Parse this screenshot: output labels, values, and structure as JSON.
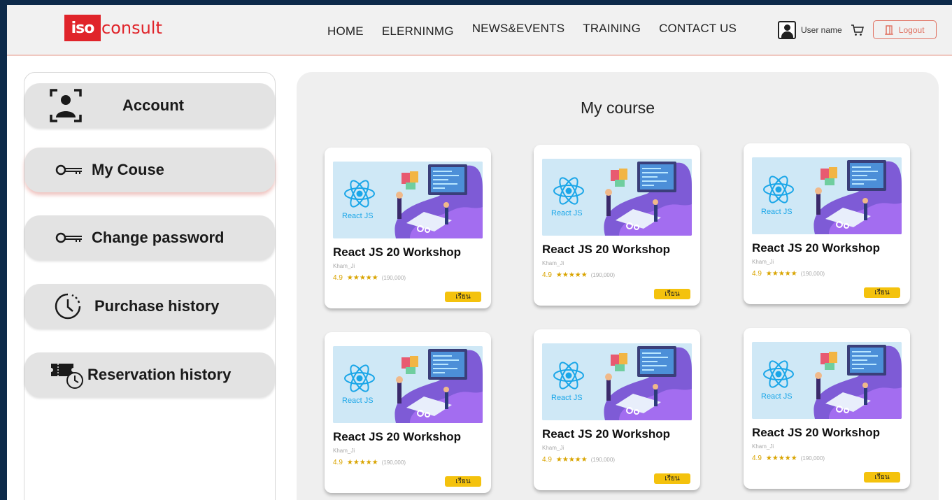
{
  "brand": {
    "logo_mark": "iso",
    "logo_text": "consult"
  },
  "nav": [
    "HOME",
    "ELERNINMG",
    "NEWS&EVENTS",
    "TRAINING",
    "CONTACT US"
  ],
  "user": {
    "name": "User name",
    "logout": "Logout"
  },
  "sidebar": {
    "items": [
      {
        "label": "Account",
        "icon": "account-icon"
      },
      {
        "label": "My Couse",
        "icon": "key-icon"
      },
      {
        "label": "Change password",
        "icon": "key-icon"
      },
      {
        "label": "Purchase history",
        "icon": "clock-icon"
      },
      {
        "label": "Reservation history",
        "icon": "ticket-clock-icon"
      }
    ],
    "active": "My Couse"
  },
  "main": {
    "title": "My course",
    "courses": [
      {
        "thumb_label": "React JS",
        "title": "React JS 20 Workshop",
        "author": "Kham_Ji",
        "rating": "4.9",
        "stars": "★★★★★",
        "count": "(190,000)",
        "button": "เรียน"
      },
      {
        "thumb_label": "React JS",
        "title": "React JS 20 Workshop",
        "author": "Kham_Ji",
        "rating": "4.9",
        "stars": "★★★★★",
        "count": "(190,000)",
        "button": "เรียน"
      },
      {
        "thumb_label": "React JS",
        "title": "React JS 20 Workshop",
        "author": "Kham_Ji",
        "rating": "4.9",
        "stars": "★★★★★",
        "count": "(190,000)",
        "button": "เรียน"
      },
      {
        "thumb_label": "React JS",
        "title": "React JS 20 Workshop",
        "author": "Kham_Ji",
        "rating": "4.9",
        "stars": "★★★★★",
        "count": "(190,000)",
        "button": "เรียน"
      },
      {
        "thumb_label": "React JS",
        "title": "React JS 20 Workshop",
        "author": "Kham_Ji",
        "rating": "4.9",
        "stars": "★★★★★",
        "count": "(190,000)",
        "button": "เรียน"
      },
      {
        "thumb_label": "React JS",
        "title": "React JS 20 Workshop",
        "author": "Kham_Ji",
        "rating": "4.9",
        "stars": "★★★★★",
        "count": "(190,000)",
        "button": "เรียน"
      }
    ]
  },
  "colors": {
    "brand_red": "#e0242a",
    "button_yellow": "#f4c20d",
    "rating_gold": "#d9a400",
    "logout_border": "#e07060",
    "page_bg": "#0d2a4a"
  }
}
